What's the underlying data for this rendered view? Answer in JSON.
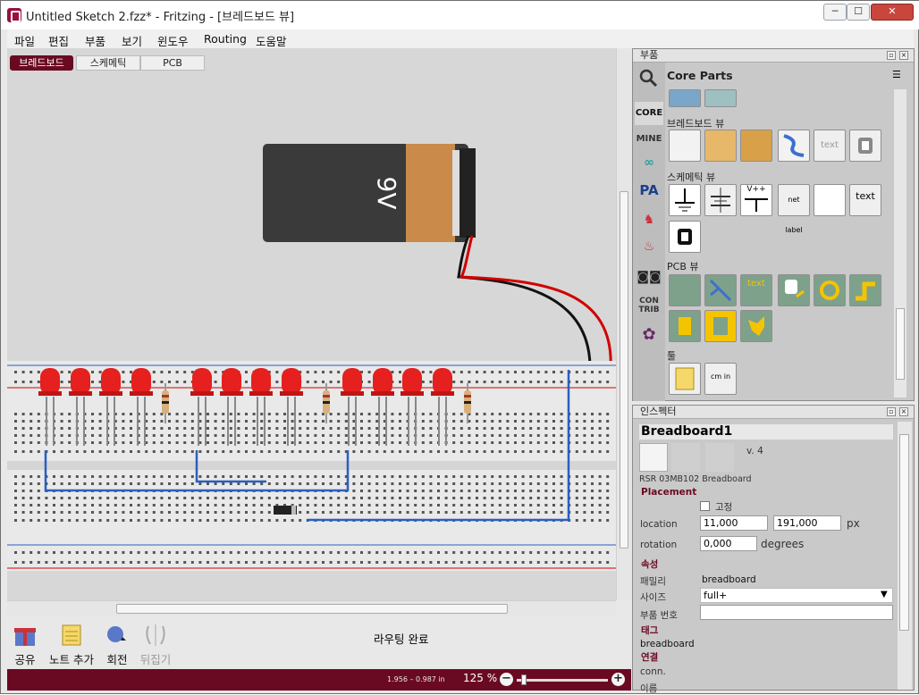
{
  "window": {
    "title": "Untitled Sketch 2.fzz* - Fritzing - [브레드보드 뷰]",
    "minimize": "─",
    "maximize": "☐",
    "close": "✕"
  },
  "menu": [
    "파일",
    "편집",
    "부품",
    "보기",
    "윈도우",
    "Routing",
    "도움말"
  ],
  "view_tabs": {
    "breadboard": "브레드보드",
    "schematic": "스케메틱",
    "pcb": "PCB"
  },
  "canvas": {
    "battery_label": "9V",
    "accent": "#6a0a22",
    "wire_red": "#d10000",
    "wire_blue": "#2a5fbf"
  },
  "bottom_tools": [
    {
      "label": "공유",
      "icon": "gift-icon"
    },
    {
      "label": "노트 추가",
      "icon": "note-icon"
    },
    {
      "label": "회전",
      "icon": "rotate-icon"
    },
    {
      "label": "뒤집기",
      "icon": "flip-icon"
    }
  ],
  "routing_status": "라우팅 완료",
  "status": {
    "coords": "1.956 – 0.987 in",
    "zoom": "125 %"
  },
  "parts_panel": {
    "title": "부품",
    "bin_title": "Core Parts",
    "bins": [
      "CORE",
      "MINE",
      "CON TRIB"
    ],
    "sections": {
      "breadboard": "브레드보드 뷰",
      "schematic": "스케메틱 뷰",
      "pcb": "PCB 뷰",
      "tools": "툴"
    },
    "part_texts": {
      "text": "text",
      "net_label": "net label",
      "vcc": "V++",
      "ruler": "cm in"
    }
  },
  "inspector": {
    "title": "인스펙터",
    "name": "Breadboard1",
    "version": "v. 4",
    "description": "RSR 03MB102 Breadboard",
    "placement_label": "Placement",
    "lock_label": "고정",
    "location_label": "location",
    "location_x": "11,000",
    "location_y": "191,000",
    "location_unit": "px",
    "rotation_label": "rotation",
    "rotation_value": "0,000",
    "rotation_unit": "degrees",
    "props_label": "속성",
    "family_label": "패밀리",
    "family_value": "breadboard",
    "size_label": "사이즈",
    "size_value": "full+",
    "partnum_label": "부품 번호",
    "tags_label": "태그",
    "tags_value": "breadboard",
    "conn_label": "연결",
    "conn_value": "conn.",
    "more_label": "이름"
  }
}
